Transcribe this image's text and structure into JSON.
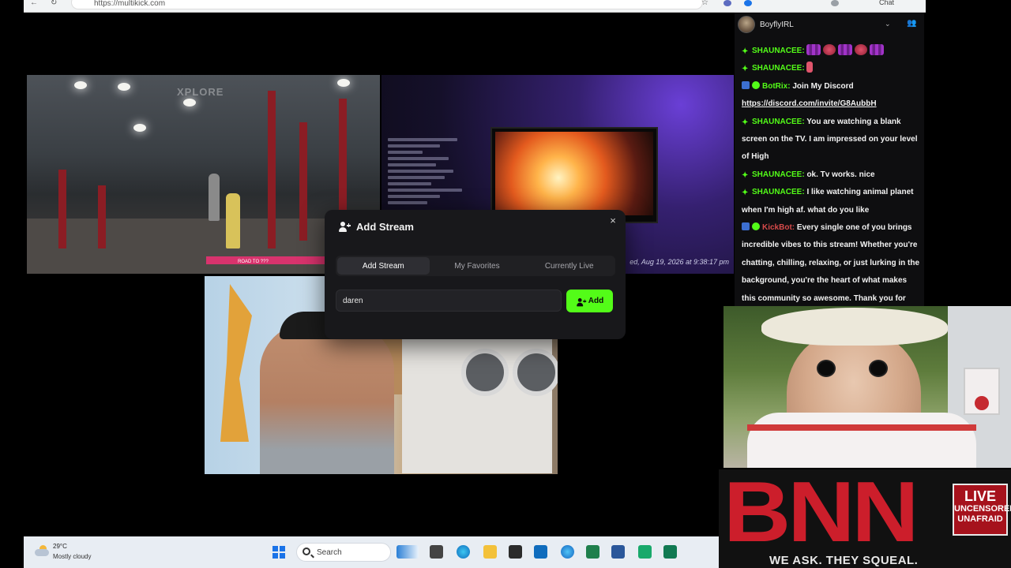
{
  "browser": {
    "url": "https://multikick.com",
    "chat_label": "Chat"
  },
  "streams": {
    "gym_overlay_logo": "XPLORE",
    "gym_tag": "ROAD TO ???",
    "tv_timestamp": "ed, Aug 19, 2026 at 9:38:17 pm"
  },
  "modal": {
    "title": "Add Stream",
    "close": "×",
    "tabs": [
      {
        "label": "Add Stream",
        "active": true
      },
      {
        "label": "My Favorites",
        "active": false
      },
      {
        "label": "Currently Live",
        "active": false
      }
    ],
    "input_value": "daren",
    "add_label": "Add",
    "accent": "#53fc18"
  },
  "chat": {
    "channel": "BoyflyIRL",
    "messages": [
      {
        "user": "SHAUNACEE:",
        "user_color": "#53fc18",
        "badges": [
          "diamond"
        ],
        "emotes": [
          "purple",
          "red",
          "purple",
          "red",
          "purple"
        ],
        "text": ""
      },
      {
        "user": "SHAUNACEE:",
        "user_color": "#53fc18",
        "badges": [
          "diamond"
        ],
        "emotes": [
          "ticket"
        ],
        "text": ""
      },
      {
        "user": "BotRix:",
        "user_color": "#53fc18",
        "badges": [
          "bot",
          "check"
        ],
        "text": "Join My Discord"
      },
      {
        "user": "",
        "user_color": "#ffffff",
        "badges": [],
        "link": "https://discord.com/invite/G8AubbH",
        "text": ""
      },
      {
        "user": "SHAUNACEE:",
        "user_color": "#53fc18",
        "badges": [
          "diamond"
        ],
        "text": "You are watching a blank screen on the TV. I am impressed on your level of High"
      },
      {
        "user": "SHAUNACEE:",
        "user_color": "#53fc18",
        "badges": [
          "diamond"
        ],
        "text": "ok. Tv works. nice"
      },
      {
        "user": "SHAUNACEE:",
        "user_color": "#53fc18",
        "badges": [
          "diamond"
        ],
        "text": "I like watching animal planet when I'm high af. what do you like"
      },
      {
        "user": "KickBot:",
        "user_color": "#d64a4a",
        "badges": [
          "bot",
          "check"
        ],
        "text": "Every single one of you brings incredible vibes to this stream! Whether you're chatting, chilling, relaxing, or just lurking in the background, you're the heart of what makes this community so awesome. Thank you for"
      }
    ]
  },
  "overlay": {
    "bnn_letters": "BNN",
    "live": "LIVE",
    "uncensored": "UNCENSORED",
    "unafraid": "UNAFRAID",
    "tagline": "WE ASK. THEY SQUEAL."
  },
  "taskbar": {
    "temperature": "29°C",
    "condition": "Mostly cloudy",
    "search_placeholder": "Search"
  }
}
